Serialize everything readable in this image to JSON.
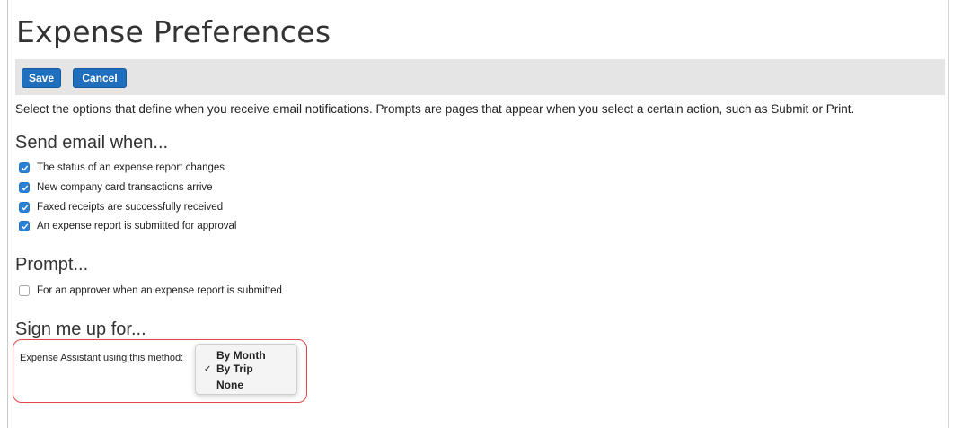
{
  "page": {
    "title": "Expense Preferences",
    "intro": "Select the options that define when you receive email notifications. Prompts are pages that appear when you select a certain action, such as Submit or Print."
  },
  "toolbar": {
    "save_label": "Save",
    "cancel_label": "Cancel",
    "button_color": "#1f6fbf"
  },
  "email_section": {
    "heading": "Send email when...",
    "options": [
      {
        "label": "The status of an expense report changes",
        "checked": true
      },
      {
        "label": "New company card transactions arrive",
        "checked": true
      },
      {
        "label": "Faxed receipts are successfully received",
        "checked": true
      },
      {
        "label": "An expense report is submitted for approval",
        "checked": true
      }
    ]
  },
  "prompt_section": {
    "heading": "Prompt...",
    "options": [
      {
        "label": "For an approver when an expense report is submitted",
        "checked": false
      }
    ]
  },
  "signup_section": {
    "heading": "Sign me up for...",
    "assistant_label": "Expense Assistant using this method:",
    "method_options": [
      "By Month",
      "By Trip",
      "None"
    ],
    "selected_method": "By Trip",
    "highlight_color": "#e0464a"
  },
  "colors": {
    "checkbox_checked": "#2a82d8",
    "toolbar_bg": "#e5e5e5"
  }
}
